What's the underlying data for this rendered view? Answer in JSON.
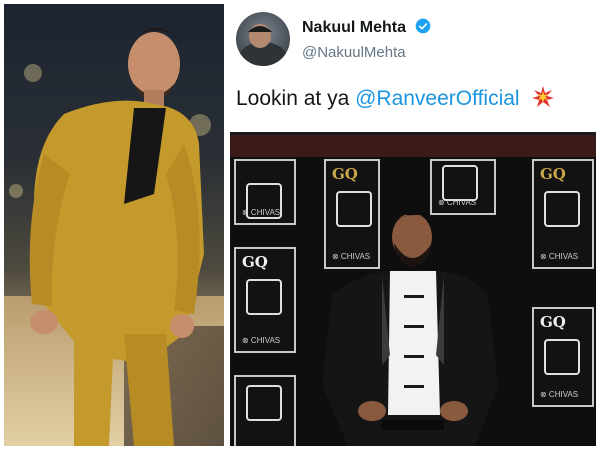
{
  "tweet": {
    "display_name": "Nakuul Mehta",
    "handle": "@NakuulMehta",
    "text_prefix": "Lookin at ya",
    "mention": "@RanveerOfficial",
    "emoji_icon": "collision-sparkle-icon",
    "verified_icon": "verified-badge-icon"
  },
  "media": {
    "panels": [
      {
        "gq": "GQ",
        "chivas": "⊗ CHIVAS"
      },
      {
        "gq": "GQ",
        "chivas": "⊗ CHIVAS"
      },
      {
        "gq": "GQ",
        "chivas": "⊗ CHIVAS"
      },
      {
        "gq": "GQ",
        "chivas": "⊗ CHIVAS"
      },
      {
        "gq": "GQ",
        "chivas": "⊗ CHIVAS"
      },
      {
        "gq": "GQ",
        "chivas": "⊗ CHIVAS"
      }
    ]
  },
  "colors": {
    "mention": "#1b95e0",
    "verified": "#1da1f2",
    "suit_left": "#c49a2c",
    "suit_right": "#141414"
  }
}
